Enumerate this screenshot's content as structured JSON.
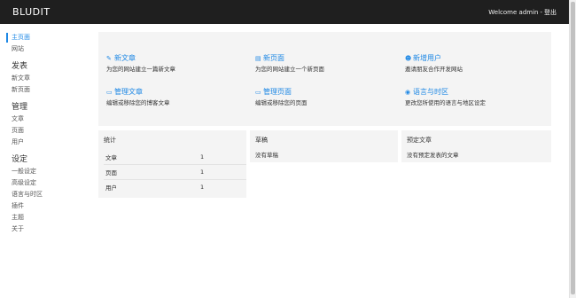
{
  "header": {
    "brand": "BLUDIT",
    "welcome": "Welcome admin",
    "separator": "-",
    "logout": "登出"
  },
  "sidebar": {
    "dashboard": "主页面",
    "website": "网站",
    "publish_heading": "发表",
    "new_post": "新文章",
    "new_page": "新页面",
    "manage_heading": "管理",
    "posts": "文章",
    "pages": "页面",
    "users": "用户",
    "settings_heading": "设定",
    "general": "一般设定",
    "advanced": "高级设定",
    "language_timezone": "语言与时区",
    "plugins": "插件",
    "themes": "主题",
    "about": "关于"
  },
  "quick_actions": [
    {
      "icon": "pencil-icon",
      "glyph": "✎",
      "title": "新文章",
      "desc": "为您的网站建立一篇新文章"
    },
    {
      "icon": "file-icon",
      "glyph": "▤",
      "title": "新页面",
      "desc": "为您的网站建立一个新页面"
    },
    {
      "icon": "user-add-icon",
      "glyph": "☻",
      "title": "新增用户",
      "desc": "邀请朋友合作开发网站"
    },
    {
      "icon": "folder-icon",
      "glyph": "▭",
      "title": "管理文章",
      "desc": "编辑或移除您的博客文章"
    },
    {
      "icon": "folder-icon",
      "glyph": "▭",
      "title": "管理页面",
      "desc": "编辑或移除您的页面"
    },
    {
      "icon": "globe-icon",
      "glyph": "◉",
      "title": "语言与时区",
      "desc": "更改您所使用的语言与地区设定"
    }
  ],
  "stats": {
    "title": "统计",
    "rows": [
      {
        "label": "文章",
        "value": "1"
      },
      {
        "label": "页面",
        "value": "1"
      },
      {
        "label": "用户",
        "value": "1"
      }
    ]
  },
  "drafts": {
    "title": "草稿",
    "empty": "没有草稿"
  },
  "scheduled": {
    "title": "预定文章",
    "empty": "没有预定发表的文章"
  }
}
